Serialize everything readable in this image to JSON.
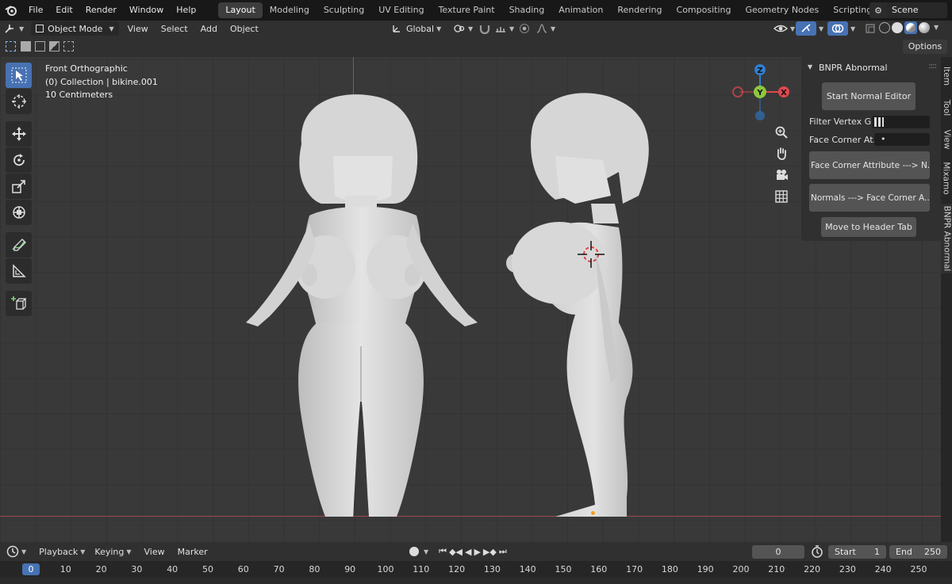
{
  "menubar": {
    "items": [
      "File",
      "Edit",
      "Render",
      "Window",
      "Help"
    ],
    "workspaces": [
      "Layout",
      "Modeling",
      "Sculpting",
      "UV Editing",
      "Texture Paint",
      "Shading",
      "Animation",
      "Rendering",
      "Compositing",
      "Geometry Nodes",
      "Scripting"
    ],
    "active_workspace": "Layout",
    "add_workspace": "+",
    "scene": "Scene"
  },
  "header": {
    "mode": "Object Mode",
    "menus": [
      "View",
      "Select",
      "Add",
      "Object"
    ],
    "orientation": "Global",
    "options": "Options"
  },
  "viewport": {
    "view_name": "Front Orthographic",
    "collection": "(0) Collection | bikine.001",
    "scale": "10 Centimeters",
    "gizmo": {
      "z": "Z",
      "y": "Y",
      "x": "X"
    }
  },
  "npanel": {
    "title": "BNPR Abnormal",
    "start_button": "Start Normal Editor",
    "filter_label": "Filter Vertex G...",
    "face_corner_label": "Face Corner At...",
    "face_corner_value": "•",
    "btn_fc_to_n": "Face Corner Attribute  --->  N...",
    "btn_n_to_fc": "Normals  --->  Face Corner A...",
    "move_button": "Move to Header Tab"
  },
  "side_tabs": [
    "Item",
    "Tool",
    "View",
    "Mixamo",
    "BNPR Abnormal"
  ],
  "timeline": {
    "menus": [
      "Playback",
      "Keying",
      "View",
      "Marker"
    ],
    "current_frame": "0",
    "start_label": "Start",
    "start_value": "1",
    "end_label": "End",
    "end_value": "250",
    "ruler": [
      "0",
      "10",
      "20",
      "30",
      "40",
      "50",
      "60",
      "70",
      "80",
      "90",
      "100",
      "110",
      "120",
      "130",
      "140",
      "150",
      "160",
      "170",
      "180",
      "190",
      "200",
      "210",
      "220",
      "230",
      "240",
      "250"
    ]
  },
  "colors": {
    "accent": "#4772b3",
    "x_axis": "#e0474f",
    "y_axis": "#8cc63e",
    "z_axis": "#2e7fd0"
  }
}
